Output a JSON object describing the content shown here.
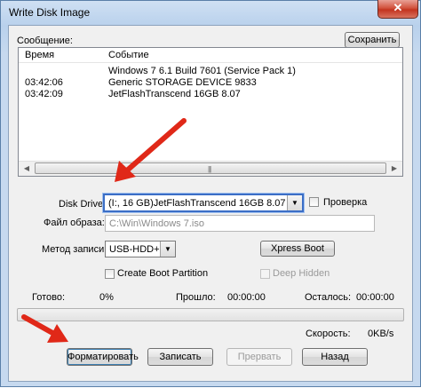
{
  "window": {
    "title": "Write Disk Image",
    "close_glyph": "✕"
  },
  "log": {
    "group_label": "Сообщение:",
    "save_button": "Сохранить",
    "columns": [
      "Время",
      "Событие"
    ],
    "rows": [
      {
        "time": "",
        "event": "Windows 7 6.1 Build 7601 (Service Pack 1)"
      },
      {
        "time": "03:42:06",
        "event": "Generic STORAGE DEVICE  9833"
      },
      {
        "time": "03:42:09",
        "event": "JetFlashTranscend 16GB  8.07"
      }
    ]
  },
  "disk_drive": {
    "label": "Disk Drive:",
    "value": "(I:, 16 GB)JetFlashTranscend 16GB  8.07",
    "verify_label": "Проверка"
  },
  "image_file": {
    "label": "Файл образа:",
    "value": "C:\\Win\\Windows 7.iso"
  },
  "write_method": {
    "label": "Метод записи:",
    "value": "USB-HDD+",
    "xpress_button": "Xpress Boot"
  },
  "options": {
    "create_boot_partition": "Create Boot Partition",
    "deep_hidden": "Deep Hidden"
  },
  "status": {
    "done_label": "Готово:",
    "done_value": "0%",
    "elapsed_label": "Прошло:",
    "elapsed_value": "00:00:00",
    "remaining_label": "Осталось:",
    "remaining_value": "00:00:00",
    "speed_label": "Скорость:",
    "speed_value": "0KB/s",
    "progress_fraction": 0
  },
  "buttons": {
    "format": "Форматировать",
    "write": "Записать",
    "abort": "Прервать",
    "back": "Назад"
  },
  "colors": {
    "arrow": "#e02818",
    "progress_fill": "#3cb043",
    "title_bar": "#c6d9ef"
  }
}
